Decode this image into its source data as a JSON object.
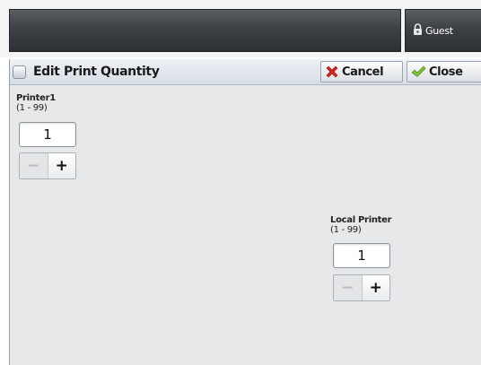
{
  "header": {
    "user_label": "Guest"
  },
  "window": {
    "title": "Edit Print Quantity",
    "cancel_label": "Cancel",
    "close_label": "Close"
  },
  "printers": [
    {
      "name": "Printer1",
      "range": "(1 - 99)",
      "quantity": "1",
      "minus": "−",
      "plus": "+"
    },
    {
      "name": "Local Printer",
      "range": "(1 - 99)",
      "quantity": "1",
      "minus": "−",
      "plus": "+"
    }
  ],
  "colors": {
    "cancel_x": "#d9261c",
    "close_check": "#7cc43a",
    "panel_dark": "#3d4145"
  }
}
